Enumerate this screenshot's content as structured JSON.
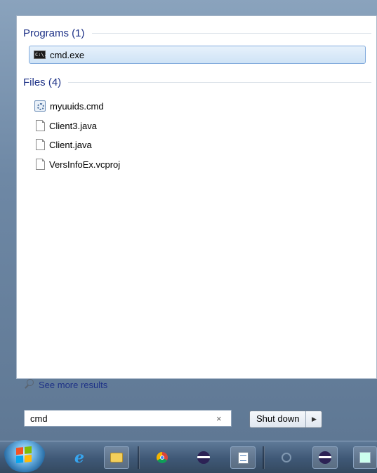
{
  "start_menu": {
    "programs_header": "Programs (1)",
    "programs": [
      {
        "label": "cmd.exe",
        "icon": "cmd-icon",
        "icon_text": "C:\\."
      }
    ],
    "files_header": "Files (4)",
    "files": [
      {
        "label": "myuuids.cmd",
        "icon": "batch-file-icon"
      },
      {
        "label": "Client3.java",
        "icon": "document-icon"
      },
      {
        "label": "Client.java",
        "icon": "document-icon"
      },
      {
        "label": "VersInfoEx.vcproj",
        "icon": "document-icon"
      }
    ],
    "see_more": "See more results",
    "search": {
      "value": "cmd",
      "clear_glyph": "×"
    },
    "shutdown": {
      "label": "Shut down",
      "arrow_glyph": "▶"
    }
  },
  "taskbar": {
    "icons": [
      "start-orb-icon",
      "internet-explorer-icon",
      "file-explorer-icon",
      "chrome-icon",
      "eclipse-icon",
      "notepad-icon",
      "search-icon",
      "eclipse-icon",
      "app-icon"
    ],
    "ie_glyph": "e"
  },
  "colors": {
    "header_text": "#1e3287",
    "selection_border": "#84acdd",
    "selection_fill": "#cfe3f6"
  }
}
